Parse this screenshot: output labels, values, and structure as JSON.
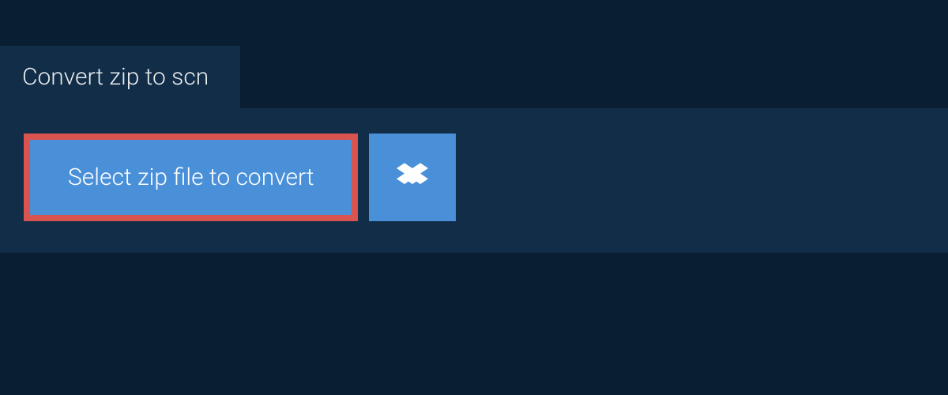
{
  "tab": {
    "title": "Convert zip to scn"
  },
  "actions": {
    "select_label": "Select zip file to convert"
  }
}
